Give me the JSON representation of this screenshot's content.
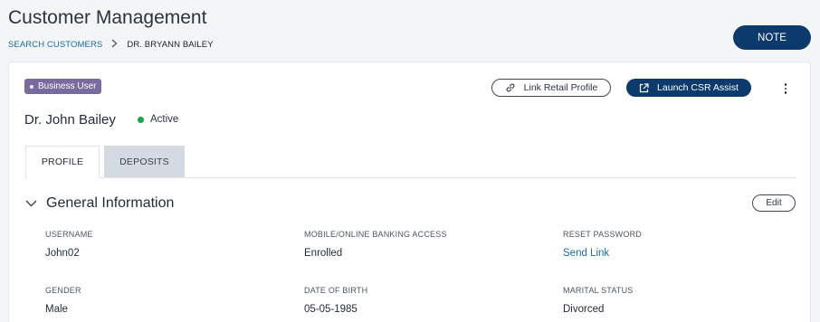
{
  "header": {
    "title": "Customer Management",
    "breadcrumb": {
      "link": "SEARCH CUSTOMERS",
      "current": "DR. BRYANN BAILEY"
    },
    "note_label": "NOTE"
  },
  "customer": {
    "badge": "Business User",
    "name": "Dr. John Bailey",
    "status": "Active",
    "status_color": "#1aa251"
  },
  "actions": {
    "link_retail": "Link Retail Profile",
    "launch_csr": "Launch  CSR Assist"
  },
  "tabs": [
    {
      "label": "PROFILE",
      "active": true
    },
    {
      "label": "DEPOSITS",
      "active": false
    }
  ],
  "section": {
    "title": "General Information",
    "edit_label": "Edit"
  },
  "fields": {
    "username": {
      "label": "USERNAME",
      "value": "John02"
    },
    "access": {
      "label": "MOBILE/ONLINE BANKING ACCESS",
      "value": "Enrolled"
    },
    "reset": {
      "label": "RESET PASSWORD",
      "value": "Send Link"
    },
    "gender": {
      "label": "GENDER",
      "value": "Male"
    },
    "dob": {
      "label": "DATE OF BIRTH",
      "value": "05-05-1985"
    },
    "marital": {
      "label": "MARITAL STATUS",
      "value": "Divorced"
    }
  },
  "colors": {
    "primary": "#0c3a6d",
    "badge": "#7a6a9e",
    "link": "#1a6aa6"
  }
}
